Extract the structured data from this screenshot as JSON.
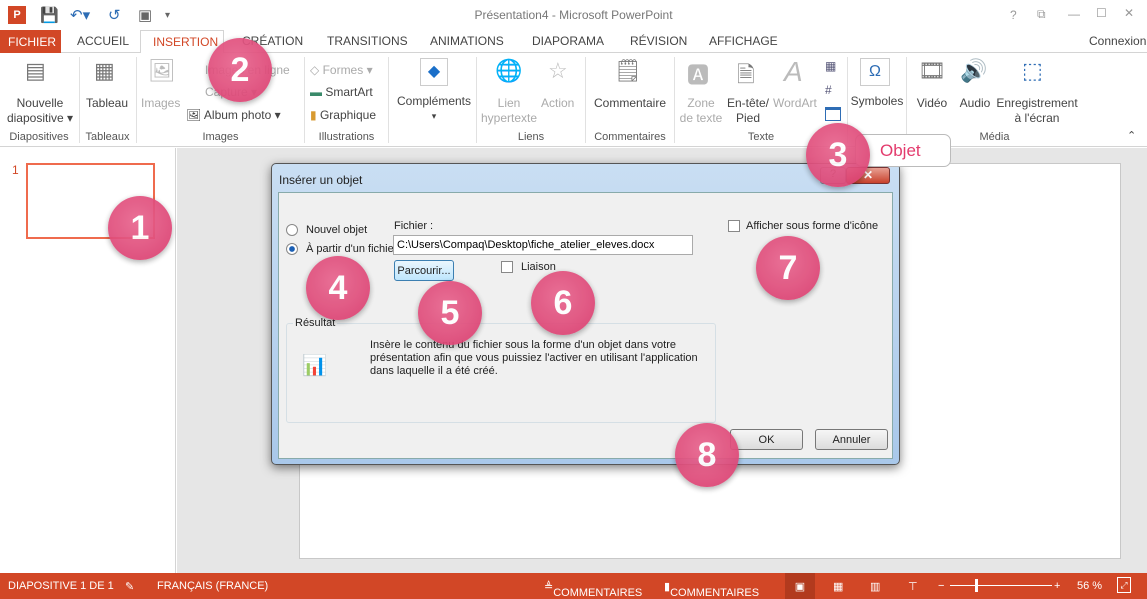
{
  "window": {
    "title": "Présentation4 - Microsoft PowerPoint",
    "controls": [
      "?",
      "⧉",
      "—",
      "☐",
      "✕"
    ],
    "signin": "Connexion"
  },
  "tabs": [
    "FICHIER",
    "ACCUEIL",
    "INSERTION",
    "CRÉATION",
    "TRANSITIONS",
    "ANIMATIONS",
    "DIAPORAMA",
    "RÉVISION",
    "AFFICHAGE"
  ],
  "ribbon": {
    "nouvelle": "Nouvelle",
    "diapositive": "diapositive ▾",
    "tableau": "Tableau",
    "images": "Images",
    "images_ligne": "Images en ligne",
    "capture": "Capture ▾",
    "album": "Album photo",
    "formes": "Formes ▾",
    "smartart": "SmartArt",
    "graphique": "Graphique",
    "complements": "Compléments",
    "lien1": "Lien",
    "lien2": "hypertexte",
    "action": "Action",
    "commentaire": "Commentaire",
    "zone1": "Zone",
    "zone2": "de texte",
    "entete1": "En-tête/",
    "entete2": "Pied",
    "wordart": "WordArt",
    "symboles": "Symboles",
    "video": "Vidéo",
    "audio": "Audio",
    "enreg1": "Enregistrement",
    "enreg2": "à l'écran",
    "groups": [
      "Diapositives",
      "Tableaux",
      "Images",
      "Illustrations",
      "Liens",
      "Commentaires",
      "Texte",
      "Média"
    ]
  },
  "slides": {
    "number": "1"
  },
  "callout": "Objet",
  "markers": [
    "1",
    "2",
    "3",
    "4",
    "5",
    "6",
    "7",
    "8"
  ],
  "dialog": {
    "title": "Insérer un objet",
    "new_object": "Nouvel objet",
    "from_file": "À partir d'un fichier",
    "selected": "from_file",
    "file_label": "Fichier :",
    "file_value": "C:\\Users\\Compaq\\Desktop\\fiche_atelier_eleves.docx",
    "browse": "Parcourir...",
    "link": "Liaison",
    "link_checked": false,
    "show_icon": "Afficher sous forme d'icône",
    "show_icon_checked": false,
    "result_label": "Résultat",
    "result_text": "Insère le contenu du fichier sous la forme d'un objet dans votre présentation afin que vous puissiez l'activer en utilisant l'application dans laquelle il a été créé.",
    "ok": "OK",
    "cancel": "Annuler"
  },
  "status": {
    "slide": "DIAPOSITIVE 1 DE 1",
    "language": "FRANÇAIS (FRANCE)",
    "notes": "COMMENTAIRES",
    "comments": "COMMENTAIRES",
    "zoom": "56 %",
    "zoom_percent": 56
  },
  "colors": {
    "accent": "#D24726",
    "marker": "#E0457B"
  }
}
